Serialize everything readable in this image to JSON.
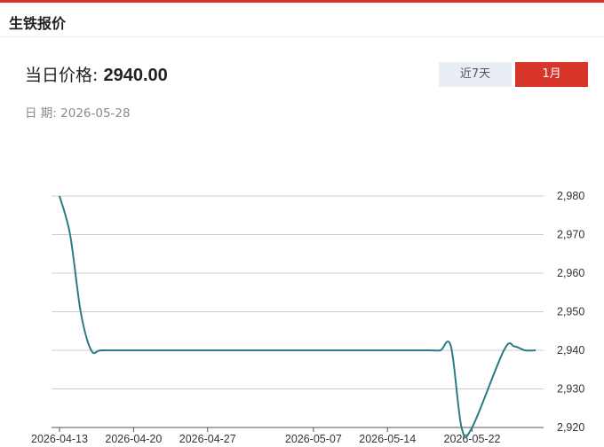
{
  "header": {
    "title": "生铁报价"
  },
  "price": {
    "label": "当日价格: ",
    "value": "2940.00"
  },
  "date": {
    "label": "日 期: ",
    "value": "2026-05-28"
  },
  "tabs": [
    {
      "label": "近7天",
      "active": false
    },
    {
      "label": "1月",
      "active": true
    }
  ],
  "colors": {
    "accent": "#d8352a",
    "line": "#2b7b86",
    "tab_inactive_bg": "#e9eef5"
  },
  "chart_data": {
    "type": "line",
    "x": [
      "2026-04-13",
      "2026-04-14",
      "2026-04-15",
      "2026-04-16",
      "2026-04-17",
      "2026-04-20",
      "2026-04-21",
      "2026-04-22",
      "2026-04-23",
      "2026-04-24",
      "2026-04-27",
      "2026-04-28",
      "2026-04-29",
      "2026-04-30",
      "2026-05-06",
      "2026-05-07",
      "2026-05-08",
      "2026-05-11",
      "2026-05-12",
      "2026-05-13",
      "2026-05-14",
      "2026-05-15",
      "2026-05-18",
      "2026-05-19",
      "2026-05-20",
      "2026-05-21",
      "2026-05-22",
      "2026-05-25",
      "2026-05-26",
      "2026-05-27",
      "2026-05-28"
    ],
    "values": [
      2980,
      2970,
      2950,
      2940,
      2940,
      2940,
      2940,
      2940,
      2940,
      2940,
      2940,
      2940,
      2940,
      2940,
      2940,
      2940,
      2940,
      2940,
      2940,
      2940,
      2940,
      2940,
      2940,
      2940,
      2941,
      2920,
      2920,
      2940,
      2941,
      2940,
      2940
    ],
    "x_tick_labels": [
      "2026-04-13",
      "2026-04-20",
      "2026-04-27",
      "2026-05-07",
      "2026-05-14",
      "2026-05-22"
    ],
    "y_ticks": [
      2920,
      2930,
      2940,
      2950,
      2960,
      2970,
      2980
    ],
    "y_tick_labels": [
      "2,920",
      "2,930",
      "2,940",
      "2,950",
      "2,960",
      "2,970",
      "2,980"
    ],
    "ylim": [
      2920,
      2980
    ],
    "grid": "horizontal",
    "title": "",
    "xlabel": "",
    "ylabel": ""
  }
}
